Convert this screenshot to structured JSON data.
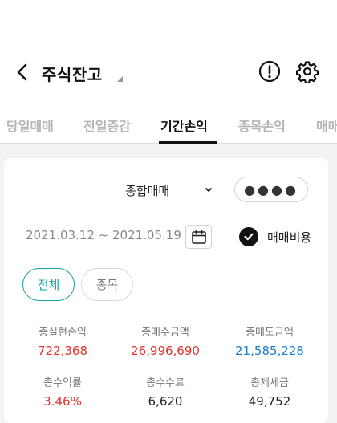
{
  "header": {
    "title": "주식잔고"
  },
  "tabs": [
    {
      "label": "당일매매"
    },
    {
      "label": "전일증감"
    },
    {
      "label": "기간손익"
    },
    {
      "label": "종목손익"
    },
    {
      "label": "매매"
    }
  ],
  "filters": {
    "account_type": "종합매매",
    "password_mask": "●●●●",
    "date_range": "2021.03.12 ~ 2021.05.19",
    "fee_label": "매매비용",
    "chip_all": "전체",
    "chip_stock": "종목"
  },
  "stats": [
    {
      "label": "총실현손익",
      "value": "722,368",
      "color": "red"
    },
    {
      "label": "총매수금액",
      "value": "26,996,690",
      "color": "red"
    },
    {
      "label": "총매도금액",
      "value": "21,585,228",
      "color": "blue"
    },
    {
      "label": "총수익률",
      "value": "3.46%",
      "color": "red"
    },
    {
      "label": "총수수료",
      "value": "6,620",
      "color": "black"
    },
    {
      "label": "총제세금",
      "value": "49,752",
      "color": "black"
    }
  ],
  "colors": {
    "accent": "#17a3a0",
    "profit": "#e0342f",
    "loss": "#1e7ec8"
  }
}
